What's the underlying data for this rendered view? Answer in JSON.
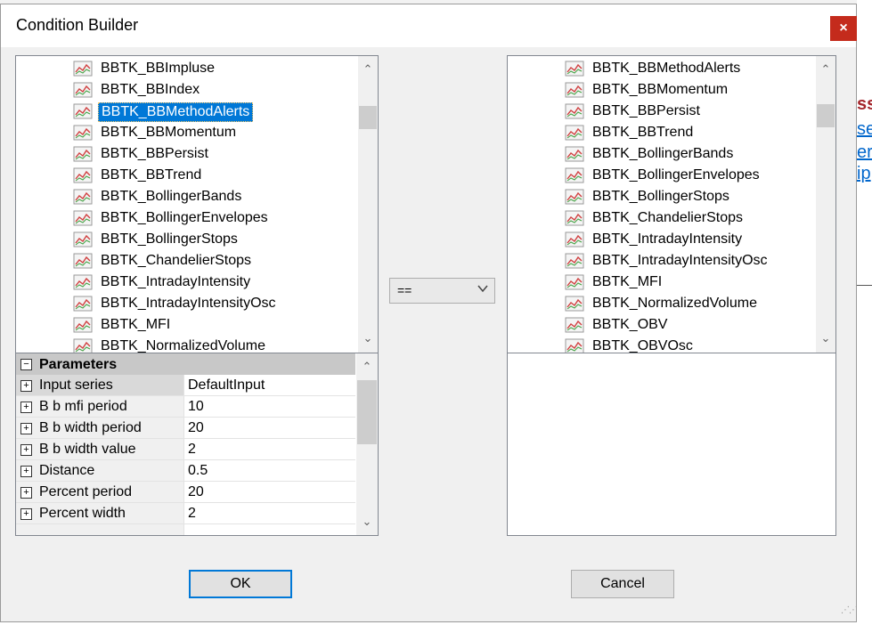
{
  "dialog": {
    "title": "Condition Builder",
    "close_glyph": "×",
    "ok_label": "OK",
    "cancel_label": "Cancel"
  },
  "left_list": {
    "items": [
      "BBTK_BBImpluse",
      "BBTK_BBIndex",
      "BBTK_BBMethodAlerts",
      "BBTK_BBMomentum",
      "BBTK_BBPersist",
      "BBTK_BBTrend",
      "BBTK_BollingerBands",
      "BBTK_BollingerEnvelopes",
      "BBTK_BollingerStops",
      "BBTK_ChandelierStops",
      "BBTK_IntradayIntensity",
      "BBTK_IntradayIntensityOsc",
      "BBTK_MFI",
      "BBTK_NormalizedVolume"
    ],
    "selected_index": 2,
    "item_icon": "indicator-chart-icon"
  },
  "right_list": {
    "items": [
      "BBTK_BBMethodAlerts",
      "BBTK_BBMomentum",
      "BBTK_BBPersist",
      "BBTK_BBTrend",
      "BBTK_BollingerBands",
      "BBTK_BollingerEnvelopes",
      "BBTK_BollingerStops",
      "BBTK_ChandelierStops",
      "BBTK_IntradayIntensity",
      "BBTK_IntradayIntensityOsc",
      "BBTK_MFI",
      "BBTK_NormalizedVolume",
      "BBTK_OBV",
      "BBTK_OBVOsc"
    ],
    "item_icon": "indicator-chart-icon"
  },
  "operator": {
    "value": "==",
    "icon": "chevron-down-icon"
  },
  "parameters": {
    "header": "Parameters",
    "expander_collapse": "⊟",
    "expander_expand": "⊞",
    "rows": [
      {
        "name": "Input series",
        "value": "DefaultInput"
      },
      {
        "name": "B b mfi period",
        "value": "10"
      },
      {
        "name": "B b width period",
        "value": "20"
      },
      {
        "name": "B b width value",
        "value": "2"
      },
      {
        "name": "Distance",
        "value": "0.5"
      },
      {
        "name": "Percent period",
        "value": "20"
      },
      {
        "name": "Percent width",
        "value": "2"
      }
    ]
  },
  "scroll": {
    "up_glyph": "⌃",
    "down_glyph": "⌄"
  },
  "colors": {
    "selection": "#0078d7",
    "close_button": "#c42b1c",
    "background_link": "#0066cc",
    "background_heading": "#a4262c"
  },
  "background_fragments": {
    "heading_char": "ss",
    "link_1": "se",
    "link_2": "er",
    "link_3": "ip"
  }
}
